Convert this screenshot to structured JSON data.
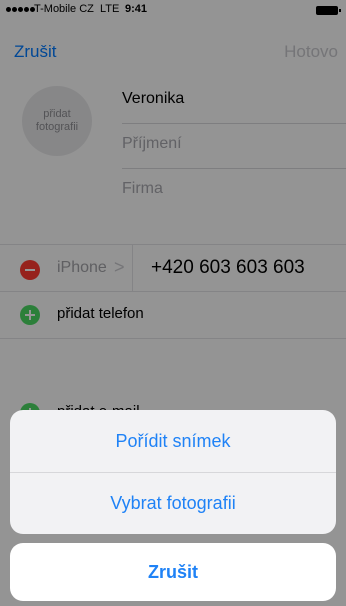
{
  "status_bar": {
    "carrier": "T-Mobile CZ",
    "network": "LTE",
    "time": "9:41"
  },
  "nav": {
    "cancel": "Zrušit",
    "done": "Hotovo"
  },
  "photo": {
    "line1": "přidat",
    "line2": "fotografii"
  },
  "fields": {
    "first_name": "Veronika",
    "last_name_placeholder": "Příjmení",
    "company_placeholder": "Firma"
  },
  "phone": {
    "label": "iPhone",
    "chevron": ">",
    "number": "+420 603 603 603"
  },
  "add": {
    "phone": "přidat telefon",
    "email": "přidat e-mail"
  },
  "action_sheet": {
    "take_photo": "Pořídit snímek",
    "choose_photo": "Vybrat fotografii",
    "cancel": "Zrušit"
  },
  "colors": {
    "accent": "#1f82f6",
    "delete": "#ff3b30",
    "add": "#4cd964",
    "overlay": "rgba(0,0,0,0.41)"
  }
}
